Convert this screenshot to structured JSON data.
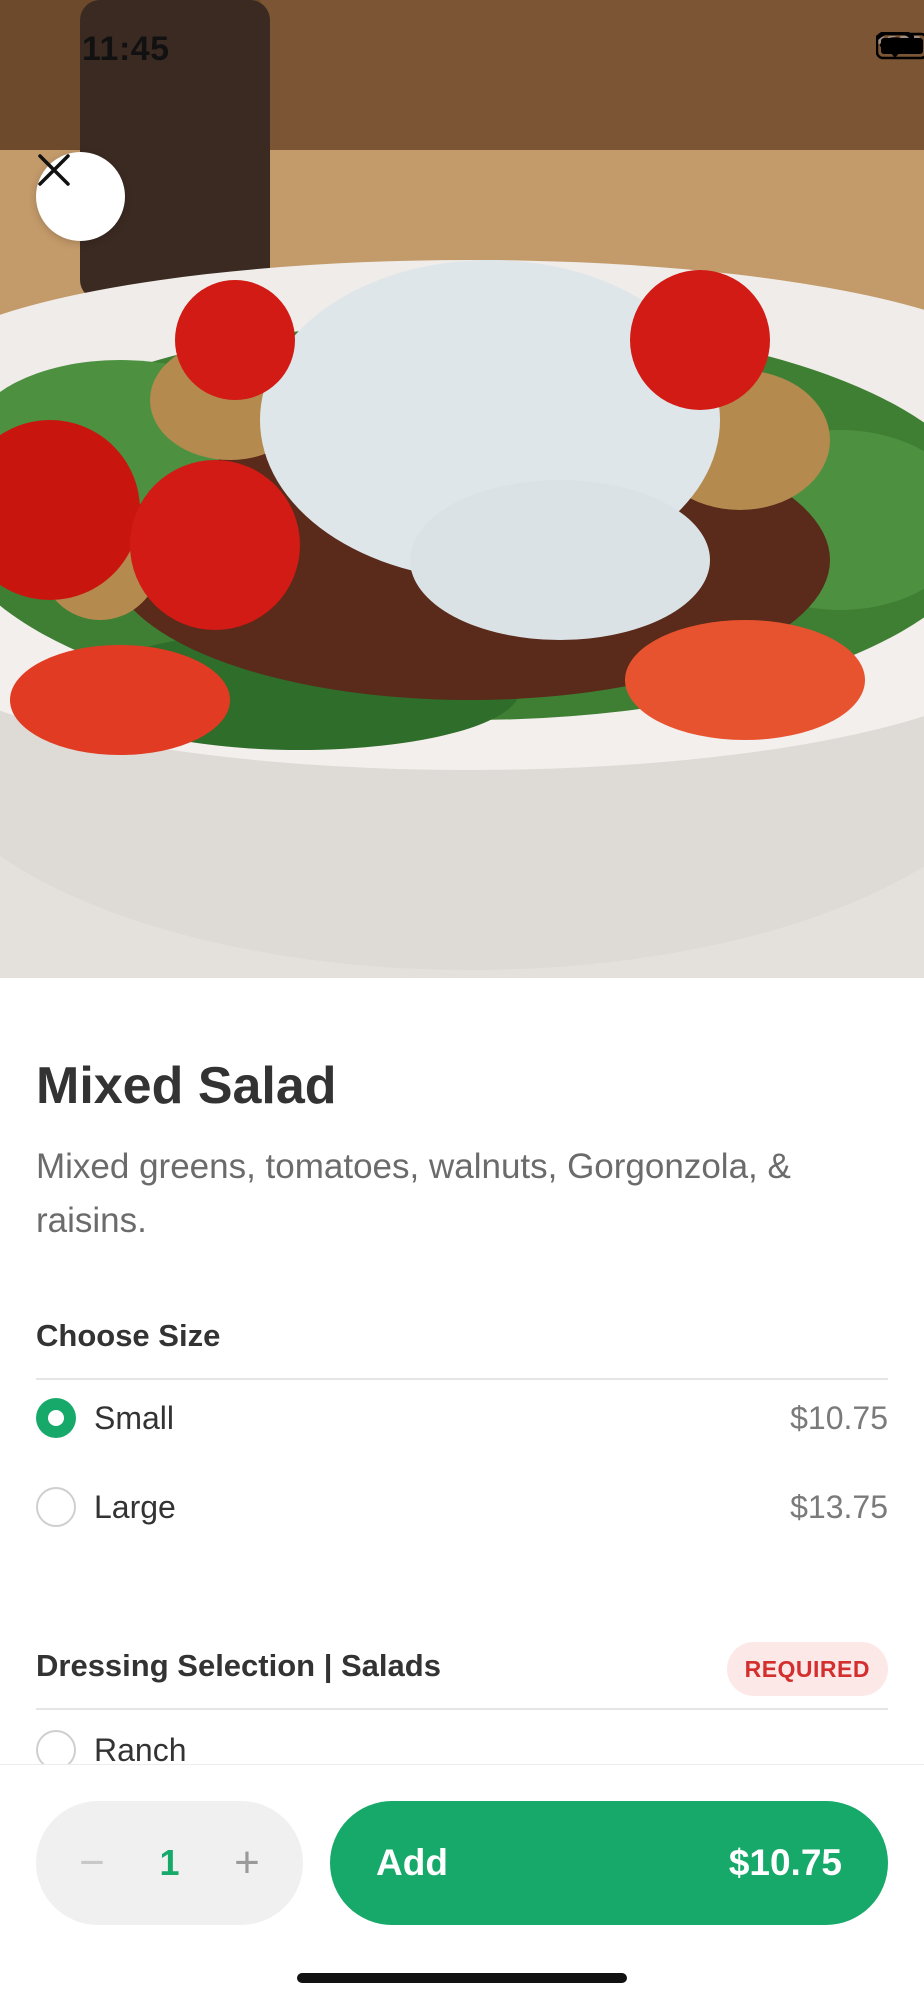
{
  "status_bar": {
    "time": "11:45"
  },
  "item": {
    "title": "Mixed Salad",
    "description": "Mixed greens, tomatoes, walnuts, Gorgonzola, & raisins."
  },
  "size_section": {
    "title": "Choose Size",
    "options": [
      {
        "label": "Small",
        "price": "$10.75",
        "selected": true
      },
      {
        "label": "Large",
        "price": "$13.75",
        "selected": false
      }
    ]
  },
  "dressing_section": {
    "title": "Dressing Selection | Salads",
    "badge": "REQUIRED",
    "options": [
      {
        "label": "Ranch",
        "selected": false
      }
    ]
  },
  "bottom_bar": {
    "quantity": "1",
    "minus": "−",
    "plus": "+",
    "add_label": "Add",
    "add_price": "$10.75"
  },
  "colors": {
    "accent": "#17a96a",
    "required_text": "#d32f2f",
    "required_bg": "#fde8e8"
  },
  "icons": {
    "close": "close-icon",
    "wifi": "wifi-icon",
    "battery": "battery-icon",
    "signal": "signal-icon"
  }
}
